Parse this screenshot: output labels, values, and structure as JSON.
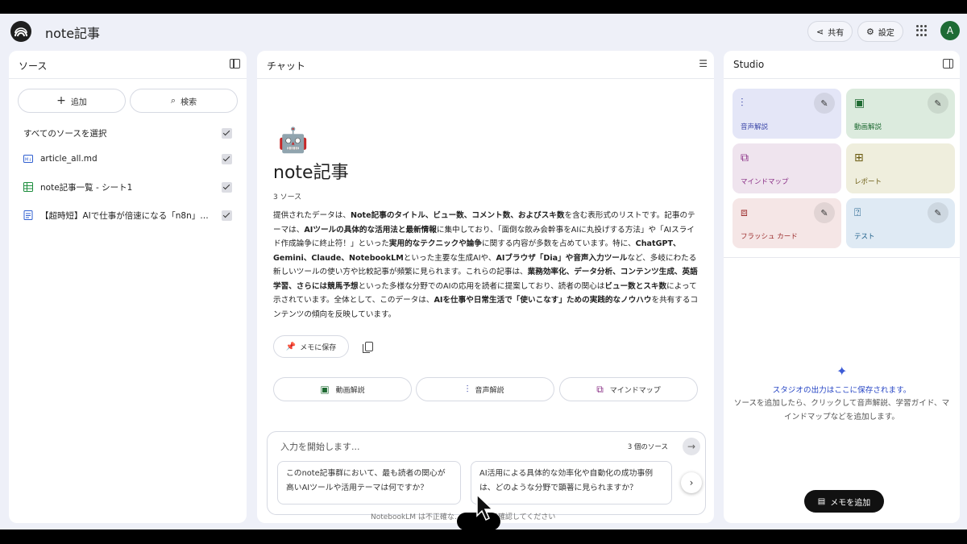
{
  "app": {
    "title": "note記事"
  },
  "topbar": {
    "share_label": "共有",
    "settings_label": "設定",
    "avatar_initial": "A"
  },
  "sources": {
    "title": "ソース",
    "add_label": "追加",
    "search_label": "検索",
    "select_all_label": "すべてのソースを選択",
    "items": [
      {
        "label": "article_all.md",
        "icon": "markdown-file-icon",
        "checked": true
      },
      {
        "label": "note記事一覧 - シート1",
        "icon": "spreadsheet-icon",
        "checked": true
      },
      {
        "label": "【超時短】AIで仕事が倍速になる「n8n」自…",
        "icon": "document-icon",
        "checked": true
      }
    ]
  },
  "chat": {
    "title": "チャット",
    "emoji": "🤖",
    "notebook_title": "note記事",
    "source_count": "3 ソース",
    "summary_segments": [
      {
        "t": "提供されたデータは、",
        "b": false
      },
      {
        "t": "Note記事のタイトル、ビュー数、コメント数、およびスキ数",
        "b": true
      },
      {
        "t": "を含む表形式のリストです。記事のテーマは、",
        "b": false
      },
      {
        "t": "AIツールの具体的な活用法と最新情報",
        "b": true
      },
      {
        "t": "に集中しており、「面倒な飲み会幹事をAIに丸投げする方法」や「AIスライド作成論争に終止符！」といった",
        "b": false
      },
      {
        "t": "実用的なテクニックや論争",
        "b": true
      },
      {
        "t": "に関する内容が多数を占めています。特に、",
        "b": false
      },
      {
        "t": "ChatGPT、Gemini、Claude、NotebookLM",
        "b": true
      },
      {
        "t": "といった主要な生成AIや、",
        "b": false
      },
      {
        "t": "AIブラウザ「Dia」や音声入力ツール",
        "b": true
      },
      {
        "t": "など、多岐にわたる新しいツールの使い方や比較記事が頻繁に見られます。これらの記事は、",
        "b": false
      },
      {
        "t": "業務効率化、データ分析、コンテンツ生成、英語学習、さらには競馬予想",
        "b": true
      },
      {
        "t": "といった多様な分野でのAIの応用を読者に提案しており、読者の関心は",
        "b": false
      },
      {
        "t": "ビュー数とスキ数",
        "b": true
      },
      {
        "t": "によって示されています。全体として、このデータは、",
        "b": false
      },
      {
        "t": "AIを仕事や日常生活で「使いこなす」ための実践的なノウハウ",
        "b": true
      },
      {
        "t": "を共有するコンテンツの傾向を反映しています。",
        "b": false
      }
    ],
    "save_memo_label": "メモに保存",
    "actions": [
      "動画解説",
      "音声解説",
      "マインドマップ"
    ],
    "input_placeholder": "入力を開始します...",
    "input_source_count": "3 個のソース",
    "suggestions": [
      "このnote記事群において、最も読者の関心が高いAIツールや活用テーマは何ですか？",
      "AI活用による具体的な効率化や自動化の成功事例は、どのような分野で顕著に見られますか？"
    ],
    "footer_note": "NotebookLM は不正確な…　回答は再確認してください"
  },
  "studio": {
    "title": "Studio",
    "tiles": [
      {
        "label": "音声解説",
        "icon": "audio-waveform-icon",
        "bg": "#e4e6f7",
        "fg": "#3b47a8",
        "editable": true
      },
      {
        "label": "動画解説",
        "icon": "video-icon",
        "bg": "#dcebde",
        "fg": "#1f6b33",
        "editable": true
      },
      {
        "label": "マインドマップ",
        "icon": "mindmap-icon",
        "bg": "#efe4ee",
        "fg": "#8a2f86",
        "editable": false
      },
      {
        "label": "レポート",
        "icon": "report-icon",
        "bg": "#efeedd",
        "fg": "#6a5a10",
        "editable": false
      },
      {
        "label": "フラッシュ カード",
        "icon": "flashcard-icon",
        "bg": "#f5e6e6",
        "fg": "#9b2b2b",
        "editable": true
      },
      {
        "label": "テスト",
        "icon": "quiz-icon",
        "bg": "#dfeaf4",
        "fg": "#1d5f8a",
        "editable": true
      }
    ],
    "empty_title": "スタジオの出力はここに保存されます。",
    "empty_desc": "ソースを追加したら、クリックして音声解説、学習ガイド、マインドマップなどを追加します。",
    "add_memo_label": "メモを追加"
  }
}
